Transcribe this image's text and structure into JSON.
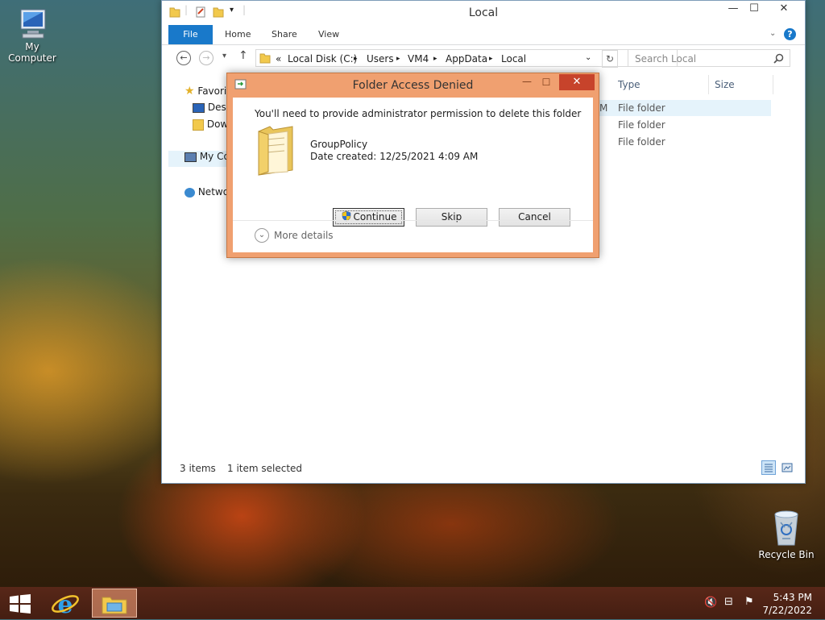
{
  "desktop": {
    "icons": [
      {
        "label": "My Computer",
        "icon": "computer-icon"
      },
      {
        "label": "Recycle Bin",
        "icon": "recycle-bin-icon"
      }
    ]
  },
  "explorer": {
    "title": "Local",
    "ribbon_tabs": [
      "File",
      "Home",
      "Share",
      "View"
    ],
    "breadcrumbs": [
      "Local Disk (C:)",
      "Users",
      "VM4",
      "AppData",
      "Local"
    ],
    "breadcrumb_overflow": "«",
    "search_placeholder": "Search Local",
    "nav_pane": [
      "Favori",
      "Desk",
      "Dow",
      "My Co",
      "Netwo"
    ],
    "columns": [
      "Type",
      "Size"
    ],
    "rows": [
      {
        "type": "File folder",
        "date_frag": "M"
      },
      {
        "type": "File folder",
        "date_frag": ""
      },
      {
        "type": "File folder",
        "date_frag": ""
      }
    ],
    "status": {
      "items": "3 items",
      "selected": "1 item selected"
    }
  },
  "dialog": {
    "title": "Folder Access Denied",
    "message": "You'll need to provide administrator permission to delete this folder",
    "folder_name": "GroupPolicy",
    "date_created": "Date created: 12/25/2021 4:09 AM",
    "buttons": {
      "continue": "Continue",
      "skip": "Skip",
      "cancel": "Cancel"
    },
    "more_details": "More details"
  },
  "taskbar": {
    "time": "5:43 PM",
    "date": "7/22/2022"
  },
  "colors": {
    "accent": "#1979ca",
    "dialog_border": "#f0a070"
  }
}
